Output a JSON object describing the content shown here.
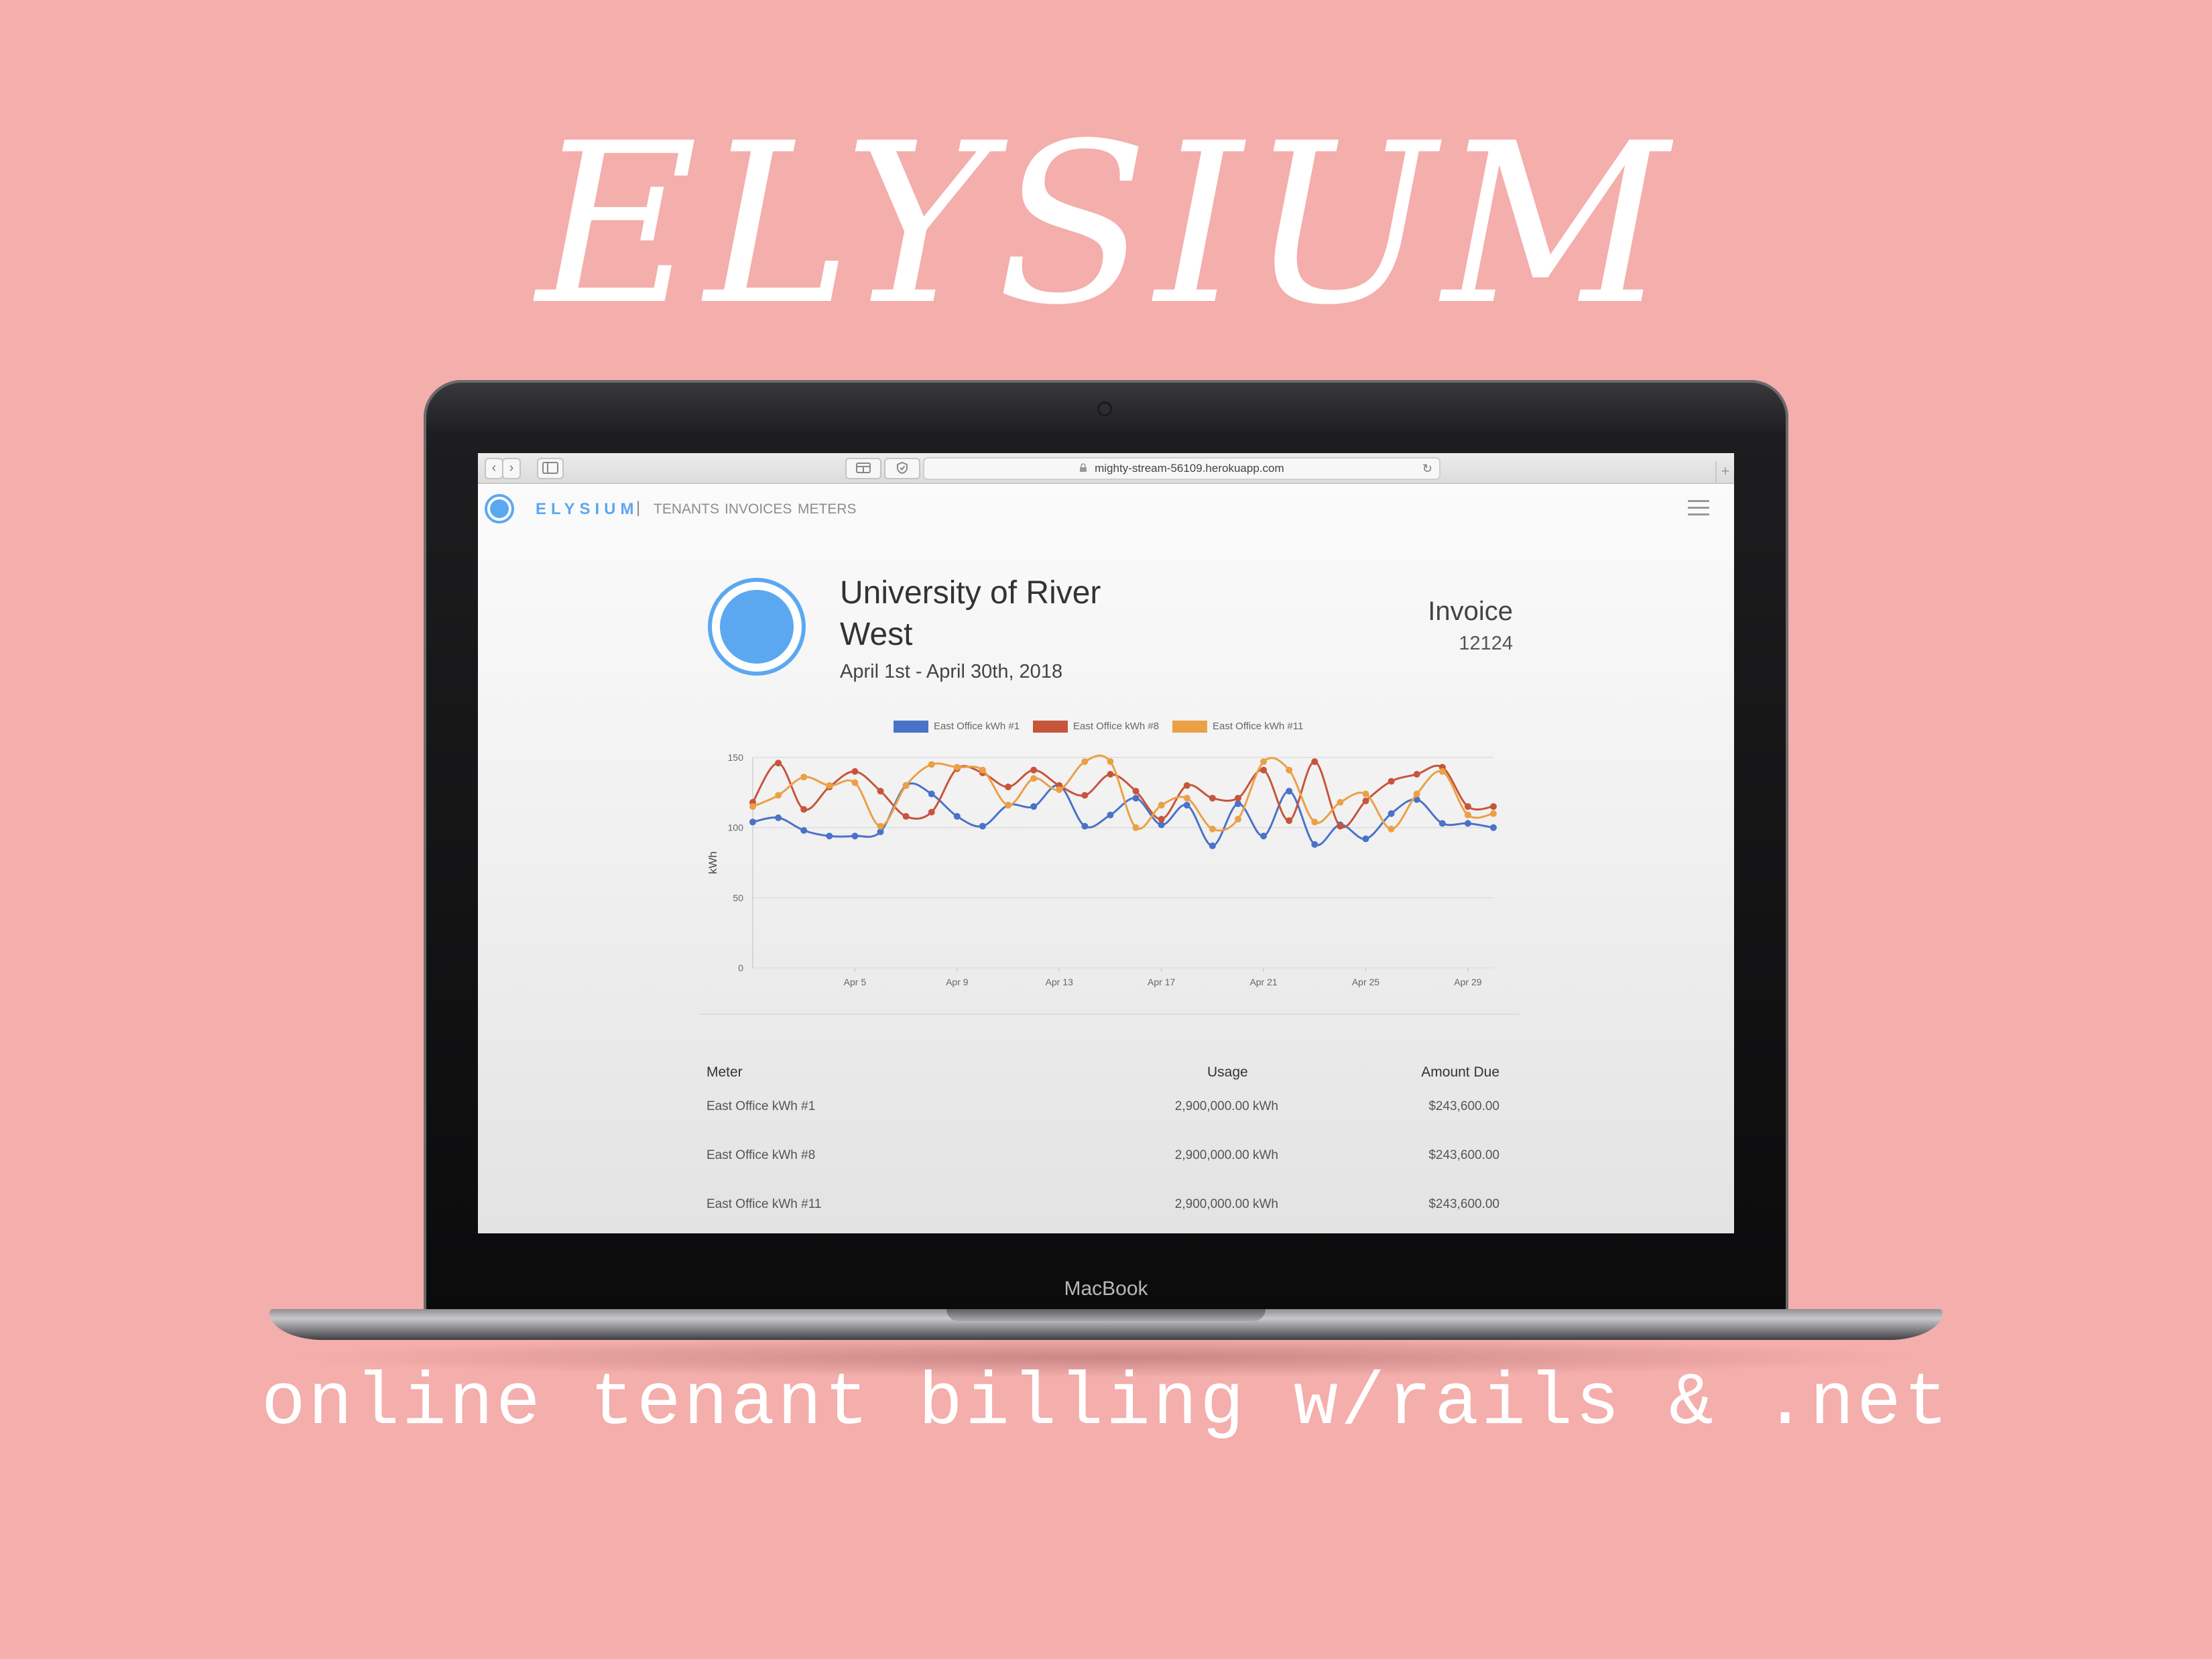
{
  "hero": {
    "title": "ELYSIUM",
    "tagline": "online tenant billing w/rails & .net"
  },
  "laptop": {
    "brand": "MacBook"
  },
  "browser": {
    "url": "mighty-stream-56109.herokuapp.com",
    "back_glyph": "‹",
    "forward_glyph": "›",
    "reload_glyph": "↻",
    "new_tab_glyph": "+"
  },
  "nav": {
    "brand": "ELYSIUM",
    "separator": "|",
    "links": [
      "TENANTS",
      "INVOICES",
      "METERS"
    ]
  },
  "invoice": {
    "tenant_line1": "University of River",
    "tenant_line2": "West",
    "period": "April 1st - April 30th, 2018",
    "label": "Invoice",
    "number": "12124"
  },
  "chart_data": {
    "type": "line",
    "title": "",
    "xlabel": "",
    "ylabel": "kWh",
    "ylim": [
      0,
      150
    ],
    "yticks": [
      0,
      50,
      100,
      150
    ],
    "grid": true,
    "legend": "top",
    "x": [
      1,
      2,
      3,
      4,
      5,
      6,
      7,
      8,
      9,
      10,
      11,
      12,
      13,
      14,
      15,
      16,
      17,
      18,
      19,
      20,
      21,
      22,
      23,
      24,
      25,
      26,
      27,
      28,
      29,
      30
    ],
    "xtick_labels": [
      "Apr 5",
      "Apr 9",
      "Apr 13",
      "Apr 17",
      "Apr 21",
      "Apr 25",
      "Apr 29"
    ],
    "xtick_positions": [
      5,
      9,
      13,
      17,
      21,
      25,
      29
    ],
    "series": [
      {
        "name": "East Office kWh #1",
        "color": "#4a72c9",
        "values": [
          104,
          107,
          98,
          94,
          94,
          97,
          130,
          124,
          108,
          101,
          116,
          115,
          130,
          101,
          109,
          121,
          102,
          116,
          87,
          117,
          94,
          126,
          88,
          102,
          92,
          110,
          120,
          103,
          103,
          100
        ]
      },
      {
        "name": "East Office kWh #8",
        "color": "#c6553b",
        "values": [
          118,
          146,
          113,
          129,
          140,
          126,
          108,
          111,
          142,
          139,
          129,
          141,
          130,
          123,
          138,
          126,
          106,
          130,
          121,
          121,
          141,
          105,
          147,
          101,
          119,
          133,
          138,
          143,
          115,
          115
        ]
      },
      {
        "name": "East Office kWh #11",
        "color": "#eba045",
        "values": [
          115,
          123,
          136,
          130,
          132,
          101,
          130,
          145,
          143,
          141,
          116,
          135,
          127,
          147,
          147,
          100,
          116,
          121,
          99,
          106,
          147,
          141,
          104,
          118,
          124,
          99,
          124,
          140,
          109,
          110
        ]
      }
    ]
  },
  "table": {
    "headers": {
      "meter": "Meter",
      "usage": "Usage",
      "amount": "Amount Due"
    },
    "rows": [
      {
        "meter": "East Office kWh #1",
        "usage": "2,900,000.00 kWh",
        "amount": "$243,600.00"
      },
      {
        "meter": "East Office kWh #8",
        "usage": "2,900,000.00 kWh",
        "amount": "$243,600.00"
      },
      {
        "meter": "East Office kWh #11",
        "usage": "2,900,000.00 kWh",
        "amount": "$243,600.00"
      }
    ]
  }
}
